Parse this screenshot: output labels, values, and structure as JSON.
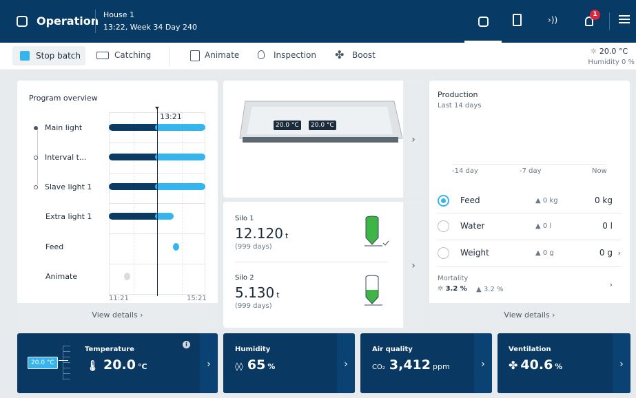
{
  "header": {
    "title": "Operation",
    "house": "House 1",
    "datetime": "13:22, Week 34 Day 240",
    "alert_count": "1"
  },
  "toolbar": {
    "stop_batch": "Stop batch",
    "catching": "Catching",
    "animate": "Animate",
    "inspection": "Inspection",
    "boost": "Boost",
    "temp": "20.0 °C",
    "humidity": "Humidity 0 %"
  },
  "program": {
    "title": "Program overview",
    "now": "13:21",
    "start": "11:21",
    "end": "15:21",
    "rows": [
      "Main light",
      "Interval t...",
      "Slave light 1",
      "Extra light 1",
      "Feed",
      "Animate"
    ],
    "view_details": "View details"
  },
  "house": {
    "t1": "20.0 °C",
    "t2": "20.0 °C"
  },
  "silos": [
    {
      "name": "Silo 1",
      "value": "12.120",
      "unit": "t",
      "days": "(999 days)",
      "fill": 0.85
    },
    {
      "name": "Silo 2",
      "value": "5.130",
      "unit": "t",
      "days": "(999 days)",
      "fill": 0.4
    }
  ],
  "production": {
    "title": "Production",
    "subtitle": "Last 14 days",
    "x_labels": [
      "-14 day",
      "-7 day",
      "Now"
    ],
    "rows": [
      {
        "label": "Feed",
        "delta": "▲ 0 kg",
        "value": "0 kg"
      },
      {
        "label": "Water",
        "delta": "▲ 0 l",
        "value": "0 l"
      },
      {
        "label": "Weight",
        "delta": "▲ 0 g",
        "value": "0 g"
      }
    ],
    "mortality_label": "Mortality",
    "mortality_value": "3.2 %",
    "mortality_delta": "▲ 3.2 %",
    "view_details": "View details"
  },
  "tiles": {
    "temperature": {
      "label": "Temperature",
      "value": "20.0",
      "unit": "°C",
      "setpoint": "20.0 °C"
    },
    "humidity": {
      "label": "Humidity",
      "value": "65",
      "unit": "%"
    },
    "air": {
      "label": "Air quality",
      "prefix": "CO₂",
      "value": "3,412",
      "unit": "ppm"
    },
    "ventilation": {
      "label": "Ventilation",
      "value": "40.6",
      "unit": "%"
    }
  },
  "colors": {
    "header": "#083a66",
    "dark_bar": "#0b3a63",
    "light_bar": "#36b4ee",
    "silo_green": "#3fb548"
  }
}
